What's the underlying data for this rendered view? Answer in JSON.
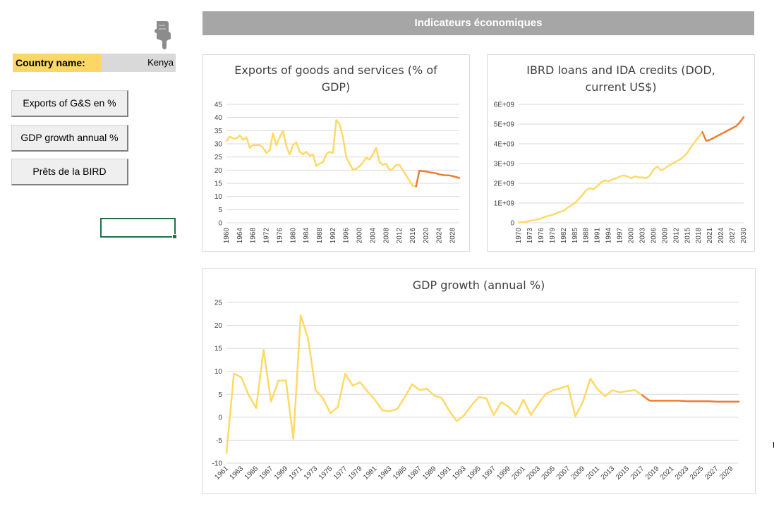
{
  "banner": {
    "title": "Indicateurs économiques"
  },
  "country": {
    "label": "Country name:",
    "value": "Kenya"
  },
  "buttons": [
    {
      "label": "Exports of G&S en %"
    },
    {
      "label": "GDP growth annual %"
    },
    {
      "label": "Prêts de la BIRD"
    }
  ],
  "icons": {
    "pointer": "pointing-hand-icon"
  },
  "colors": {
    "actual": "#ffd966",
    "forecast": "#ed7d31",
    "banner": "#a6a6a6",
    "label_fill": "#fdd766",
    "selection": "#1e7145"
  },
  "chart_data": [
    {
      "type": "line",
      "title": "Exports of goods and services (% of GDP)",
      "title_lines": [
        "Exports of goods and services (% of",
        "GDP)"
      ],
      "x": [
        1960,
        1961,
        1962,
        1963,
        1964,
        1965,
        1966,
        1967,
        1968,
        1969,
        1970,
        1971,
        1972,
        1973,
        1974,
        1975,
        1976,
        1977,
        1978,
        1979,
        1980,
        1981,
        1982,
        1983,
        1984,
        1985,
        1986,
        1987,
        1988,
        1989,
        1990,
        1991,
        1992,
        1993,
        1994,
        1995,
        1996,
        1997,
        1998,
        1999,
        2000,
        2001,
        2002,
        2003,
        2004,
        2005,
        2006,
        2007,
        2008,
        2009,
        2010,
        2011,
        2012,
        2013,
        2014,
        2015,
        2016,
        2017,
        2018,
        2019,
        2020,
        2021,
        2022,
        2023,
        2024,
        2025,
        2026,
        2027,
        2028,
        2029,
        2030
      ],
      "series": [
        {
          "values": [
            31,
            32.8,
            32,
            32,
            33.2,
            31.5,
            32.5,
            28.5,
            29.5,
            29.5,
            29.5,
            28.5,
            26.5,
            27.5,
            34,
            29.5,
            32.5,
            35,
            29,
            26,
            29.5,
            30.5,
            27,
            26,
            27,
            25.5,
            26,
            21.5,
            22.5,
            23,
            26,
            27,
            26.5,
            39,
            37.5,
            32.5,
            25,
            22.5,
            20.2,
            20.5,
            21.5,
            22.8,
            24.8,
            24,
            26,
            28.5,
            23,
            22,
            22.5,
            20,
            20.5,
            22,
            22,
            20,
            18,
            16,
            14,
            13.8,
            null,
            null,
            null,
            null,
            null,
            null,
            null,
            null,
            null,
            null,
            null,
            null,
            null
          ]
        },
        {
          "values": [
            null,
            null,
            null,
            null,
            null,
            null,
            null,
            null,
            null,
            null,
            null,
            null,
            null,
            null,
            null,
            null,
            null,
            null,
            null,
            null,
            null,
            null,
            null,
            null,
            null,
            null,
            null,
            null,
            null,
            null,
            null,
            null,
            null,
            null,
            null,
            null,
            null,
            null,
            null,
            null,
            null,
            null,
            null,
            null,
            null,
            null,
            null,
            null,
            null,
            null,
            null,
            null,
            null,
            null,
            null,
            null,
            null,
            13.8,
            19.8,
            19.6,
            19.5,
            19.2,
            19,
            18.8,
            18.4,
            18.2,
            18,
            18,
            17.7,
            17.4,
            17
          ]
        }
      ],
      "ylim": [
        0,
        45
      ],
      "yticks": [
        "0",
        "5",
        "10",
        "15",
        "20",
        "25",
        "30",
        "35",
        "40",
        "45"
      ],
      "xticks": [
        "1960",
        "1964",
        "1968",
        "1972",
        "1976",
        "1980",
        "1984",
        "1988",
        "1992",
        "1996",
        "2000",
        "2004",
        "2008",
        "2012",
        "2016",
        "2020",
        "2024",
        "2028"
      ],
      "grid": true
    },
    {
      "type": "line",
      "title": "IBRD loans and IDA credits (DOD, current US$)",
      "title_lines": [
        "IBRD loans and IDA credits (DOD,",
        "current US$)"
      ],
      "x": [
        1970,
        1971,
        1972,
        1973,
        1974,
        1975,
        1976,
        1977,
        1978,
        1979,
        1980,
        1981,
        1982,
        1983,
        1984,
        1985,
        1986,
        1987,
        1988,
        1989,
        1990,
        1991,
        1992,
        1993,
        1994,
        1995,
        1996,
        1997,
        1998,
        1999,
        2000,
        2001,
        2002,
        2003,
        2004,
        2005,
        2006,
        2007,
        2008,
        2009,
        2010,
        2011,
        2012,
        2013,
        2014,
        2015,
        2016,
        2017,
        2018,
        2019,
        2020,
        2021,
        2022,
        2023,
        2024,
        2025,
        2026,
        2027,
        2028,
        2029,
        2030
      ],
      "series": [
        {
          "values": [
            0.02,
            0.03,
            0.05,
            0.1,
            0.13,
            0.17,
            0.22,
            0.3,
            0.35,
            0.4,
            0.48,
            0.55,
            0.6,
            0.75,
            0.88,
            1.0,
            1.2,
            1.4,
            1.65,
            1.75,
            1.7,
            1.85,
            2.05,
            2.15,
            2.1,
            2.2,
            2.25,
            2.35,
            2.4,
            2.35,
            2.25,
            2.35,
            2.3,
            2.3,
            2.25,
            2.4,
            2.7,
            2.85,
            2.65,
            2.75,
            2.9,
            3.0,
            3.1,
            3.2,
            3.35,
            3.55,
            3.85,
            4.1,
            4.35,
            4.6,
            null,
            null,
            null,
            null,
            null,
            null,
            null,
            null,
            null,
            null,
            null
          ]
        },
        {
          "values": [
            null,
            null,
            null,
            null,
            null,
            null,
            null,
            null,
            null,
            null,
            null,
            null,
            null,
            null,
            null,
            null,
            null,
            null,
            null,
            null,
            null,
            null,
            null,
            null,
            null,
            null,
            null,
            null,
            null,
            null,
            null,
            null,
            null,
            null,
            null,
            null,
            null,
            null,
            null,
            null,
            null,
            null,
            null,
            null,
            null,
            null,
            null,
            null,
            null,
            4.6,
            4.15,
            4.2,
            4.3,
            4.4,
            4.5,
            4.6,
            4.7,
            4.8,
            4.9,
            5.1,
            5.35
          ]
        }
      ],
      "value_unit_note": "values in billions of US$ (1E+09)",
      "ylim": [
        0,
        6
      ],
      "yticks": [
        "0",
        "1E+09",
        "2E+09",
        "3E+09",
        "4E+09",
        "5E+09",
        "6E+09"
      ],
      "xticks": [
        "1970",
        "1973",
        "1976",
        "1979",
        "1982",
        "1985",
        "1988",
        "1991",
        "1994",
        "1997",
        "2000",
        "2003",
        "2006",
        "2009",
        "2012",
        "2015",
        "2018",
        "2021",
        "2024",
        "2027",
        "2030"
      ],
      "grid": true
    },
    {
      "type": "line",
      "title": "GDP growth (annual %)",
      "title_lines": [
        "GDP growth (annual %)"
      ],
      "x": [
        1961,
        1962,
        1963,
        1964,
        1965,
        1966,
        1967,
        1968,
        1969,
        1970,
        1971,
        1972,
        1973,
        1974,
        1975,
        1976,
        1977,
        1978,
        1979,
        1980,
        1981,
        1982,
        1983,
        1984,
        1985,
        1986,
        1987,
        1988,
        1989,
        1990,
        1991,
        1992,
        1993,
        1994,
        1995,
        1996,
        1997,
        1998,
        1999,
        2000,
        2001,
        2002,
        2003,
        2004,
        2005,
        2006,
        2007,
        2008,
        2009,
        2010,
        2011,
        2012,
        2013,
        2014,
        2015,
        2016,
        2017,
        2018,
        2019,
        2020,
        2021,
        2022,
        2023,
        2024,
        2025,
        2026,
        2027,
        2028,
        2029,
        2030
      ],
      "series": [
        {
          "values": [
            -7.8,
            9.5,
            8.7,
            4.8,
            2,
            14.7,
            3.4,
            8,
            8,
            -4.7,
            22.2,
            17.1,
            5.9,
            4.1,
            0.9,
            2.2,
            9.5,
            6.9,
            7.6,
            5.6,
            3.8,
            1.5,
            1.3,
            1.8,
            4.3,
            7.2,
            5.9,
            6.2,
            4.7,
            4.2,
            1.4,
            -0.8,
            0.4,
            2.6,
            4.4,
            4.1,
            0.5,
            3.3,
            2.3,
            0.6,
            3.8,
            0.5,
            2.9,
            5.1,
            5.9,
            6.3,
            6.9,
            0.2,
            3.3,
            8.4,
            6.1,
            4.6,
            5.9,
            5.4,
            5.7,
            5.9,
            4.8,
            null,
            null,
            null,
            null,
            null,
            null,
            null,
            null,
            null,
            null,
            null,
            null,
            null
          ]
        },
        {
          "values": [
            null,
            null,
            null,
            null,
            null,
            null,
            null,
            null,
            null,
            null,
            null,
            null,
            null,
            null,
            null,
            null,
            null,
            null,
            null,
            null,
            null,
            null,
            null,
            null,
            null,
            null,
            null,
            null,
            null,
            null,
            null,
            null,
            null,
            null,
            null,
            null,
            null,
            null,
            null,
            null,
            null,
            null,
            null,
            null,
            null,
            null,
            null,
            null,
            null,
            null,
            null,
            null,
            null,
            null,
            null,
            null,
            4.8,
            3.6,
            3.6,
            3.6,
            3.6,
            3.6,
            3.5,
            3.5,
            3.5,
            3.5,
            3.4,
            3.4,
            3.4,
            3.4
          ]
        }
      ],
      "ylim": [
        -10,
        25
      ],
      "yticks": [
        "-10",
        "-5",
        "0",
        "5",
        "10",
        "15",
        "20",
        "25"
      ],
      "xticks": [
        "1961",
        "1963",
        "1965",
        "1967",
        "1969",
        "1971",
        "1973",
        "1975",
        "1977",
        "1979",
        "1981",
        "1983",
        "1985",
        "1987",
        "1989",
        "1991",
        "1993",
        "1995",
        "1997",
        "1999",
        "2001",
        "2003",
        "2005",
        "2007",
        "2009",
        "2011",
        "2013",
        "2015",
        "2017",
        "2019",
        "2021",
        "2023",
        "2025",
        "2027",
        "2029"
      ],
      "grid": true
    }
  ]
}
